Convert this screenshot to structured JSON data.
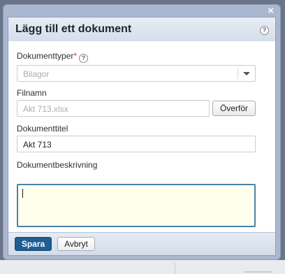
{
  "dialog": {
    "title": "Lägg till ett dokument",
    "close_glyph": "×",
    "help_glyph": "?"
  },
  "form": {
    "document_types": {
      "label": "Dokumenttyper",
      "required_mark": "*",
      "help_glyph": "?",
      "selected": "Bilagor"
    },
    "filename": {
      "label": "Filnamn",
      "value": "Akt 713.xlsx",
      "upload_button": "Överför"
    },
    "document_title": {
      "label": "Dokumenttitel",
      "value": "Akt 713"
    },
    "document_description": {
      "label": "Dokumentbeskrivning",
      "value": ""
    }
  },
  "footer": {
    "save_label": "Spara",
    "cancel_label": "Avbryt"
  },
  "colors": {
    "primary_button": "#1d5e93",
    "focused_border": "#4a82a8",
    "required_asterisk": "#d0342c",
    "dialog_chrome": "#a9b7d0"
  }
}
